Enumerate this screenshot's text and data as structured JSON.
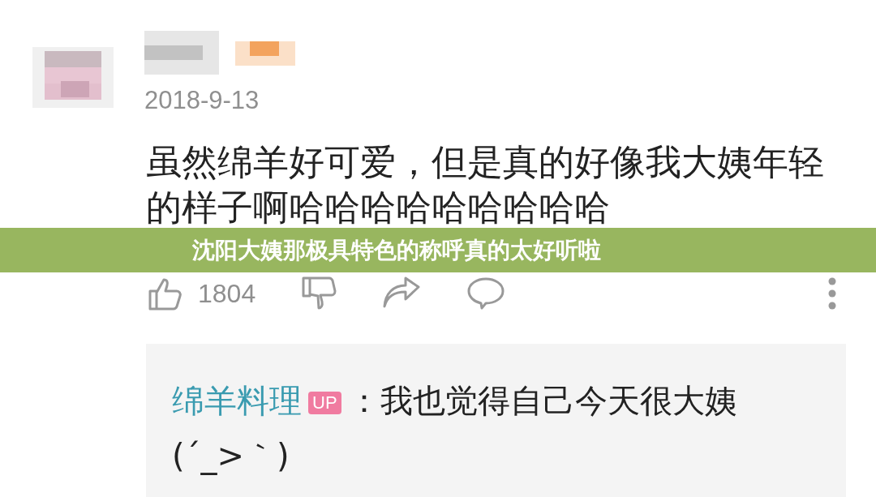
{
  "comment": {
    "date": "2018-9-13",
    "text": "虽然绵羊好可爱，但是真的好像我大姨年轻的样子啊哈哈哈哈哈哈哈哈哈",
    "like_count": "1804"
  },
  "banner": {
    "title": "沈阳大姨那极具特色的称呼真的太好听啦"
  },
  "reply": {
    "author": "绵羊料理",
    "badge": "UP",
    "text": "：我也觉得自己今天很大姨",
    "emoticon": "(´_>｀)"
  }
}
